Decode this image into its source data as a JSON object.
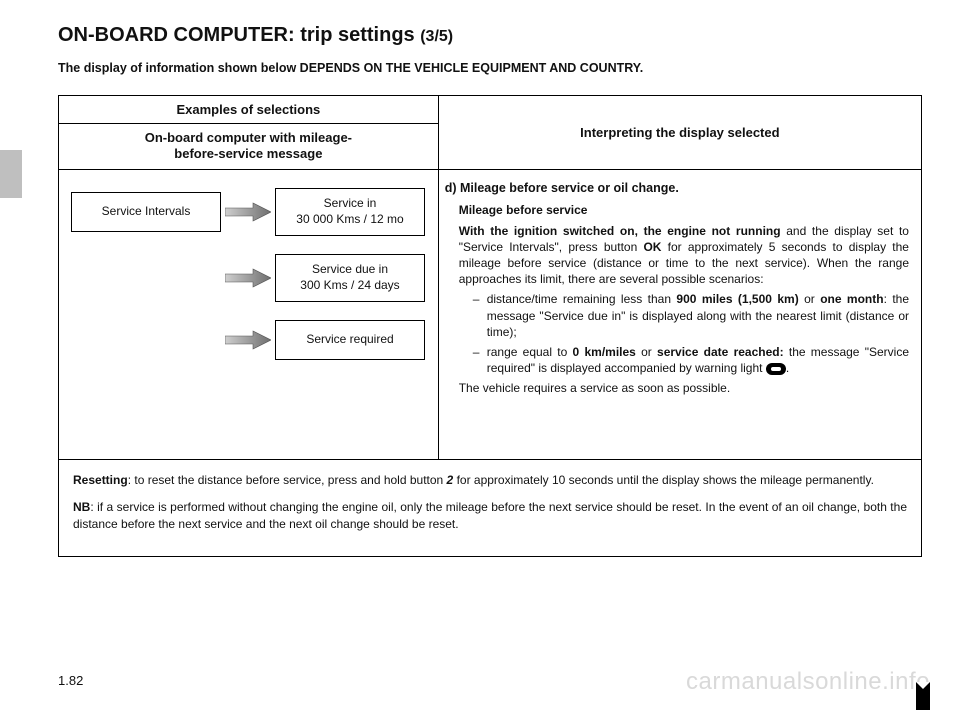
{
  "title_main": "ON-BOARD COMPUTER: trip settings ",
  "title_sub": "(3/5)",
  "depends_line": "The display of information shown below DEPENDS ON THE VEHICLE EQUIPMENT AND COUNTRY.",
  "headers": {
    "examples": "Examples of selections",
    "obc_line1": "On-board computer with mileage-",
    "obc_line2": "before-service message",
    "interpret": "Interpreting the display selected"
  },
  "boxes": {
    "service_intervals": "Service Intervals",
    "service_in_l1": "Service in",
    "service_in_l2": "30 000 Kms / 12 mo",
    "service_due_l1": "Service due in",
    "service_due_l2": "300 Kms / 24 days",
    "service_required": "Service required"
  },
  "interpret": {
    "heading": "d) Mileage before service or oil change.",
    "sub": "Mileage before service",
    "p1a": "With the ignition switched on, the engine not running",
    "p1b": " and the display set to \"Service Intervals\", press button ",
    "p1c": "OK",
    "p1d": "  for approximately 5 seconds to display the mileage before service (distance or time to the next service). When the range approaches its limit, there are several possible scenarios:",
    "li1a": "distance/time remaining less than ",
    "li1b": "900 miles (1,500 km)",
    "li1c": " or ",
    "li1d": "one month",
    "li1e": ": the message \"Service due in\" is displayed along with the nearest limit (distance or time);",
    "li2a": "range equal to ",
    "li2b": "0 km/miles",
    "li2c": " or ",
    "li2d": "service date reached:",
    "li2e": " the message \"Service required\" is displayed accompanied by warning light ",
    "li2f": ".",
    "p2": "The vehicle requires a service as soon as possible."
  },
  "footer": {
    "reset_label": "Resetting",
    "reset_text": ": to reset the distance before service, press and hold button ",
    "reset_btn": "2",
    "reset_text2": " for approximately 10 seconds until the display shows the mileage permanently.",
    "nb_label": "NB",
    "nb_text": ": if a service is performed without changing the engine oil, only the mileage before the next service should be reset. In the event of an oil change, both the distance before the next service and the next oil change should be reset."
  },
  "page_number": "1.82",
  "watermark": "carmanualsonline.info"
}
